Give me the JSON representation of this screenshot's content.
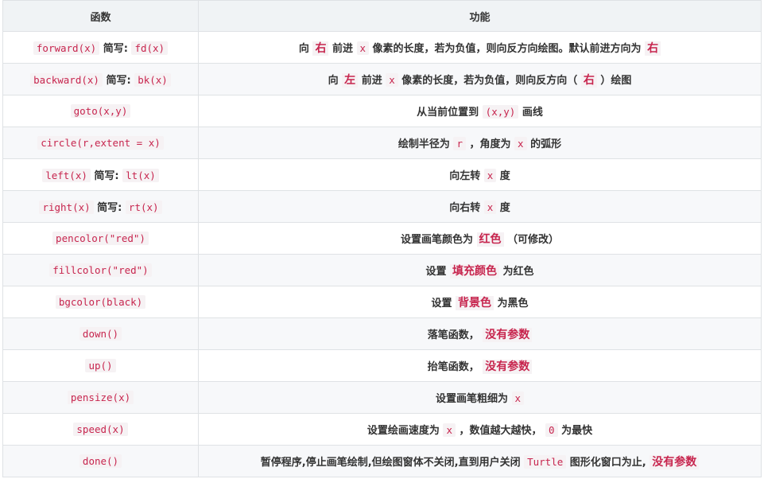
{
  "table": {
    "headers": [
      "函数",
      "功能"
    ],
    "rows": [
      {
        "func": [
          {
            "t": "code",
            "v": "forward(x)"
          },
          {
            "t": "text",
            "v": " 简写: "
          },
          {
            "t": "code",
            "v": "fd(x)"
          }
        ],
        "desc": [
          {
            "t": "text",
            "v": "向 "
          },
          {
            "t": "em",
            "v": "右"
          },
          {
            "t": "text",
            "v": " 前进 "
          },
          {
            "t": "code",
            "v": "x"
          },
          {
            "t": "text",
            "v": " 像素的长度，若为负值，则向反方向绘图。默认前进方向为 "
          },
          {
            "t": "em",
            "v": "右"
          }
        ]
      },
      {
        "func": [
          {
            "t": "code",
            "v": "backward(x)"
          },
          {
            "t": "text",
            "v": " 简写: "
          },
          {
            "t": "code",
            "v": "bk(x)"
          }
        ],
        "desc": [
          {
            "t": "text",
            "v": "向 "
          },
          {
            "t": "em",
            "v": "左"
          },
          {
            "t": "text",
            "v": " 前进 "
          },
          {
            "t": "code",
            "v": "x"
          },
          {
            "t": "text",
            "v": " 像素的长度，若为负值，则向反方向（ "
          },
          {
            "t": "em",
            "v": "右"
          },
          {
            "t": "text",
            "v": " ）绘图"
          }
        ]
      },
      {
        "func": [
          {
            "t": "code",
            "v": "goto(x,y)"
          }
        ],
        "desc": [
          {
            "t": "text",
            "v": "从当前位置到 "
          },
          {
            "t": "code",
            "v": "(x,y)"
          },
          {
            "t": "text",
            "v": " 画线"
          }
        ]
      },
      {
        "func": [
          {
            "t": "code",
            "v": "circle(r,extent = x)"
          }
        ],
        "desc": [
          {
            "t": "text",
            "v": "绘制半径为 "
          },
          {
            "t": "code",
            "v": "r"
          },
          {
            "t": "text",
            "v": " ，角度为 "
          },
          {
            "t": "code",
            "v": "x"
          },
          {
            "t": "text",
            "v": " 的弧形"
          }
        ]
      },
      {
        "func": [
          {
            "t": "code",
            "v": "left(x)"
          },
          {
            "t": "text",
            "v": " 简写: "
          },
          {
            "t": "code",
            "v": "lt(x)"
          }
        ],
        "desc": [
          {
            "t": "text",
            "v": "向左转 "
          },
          {
            "t": "code",
            "v": "x"
          },
          {
            "t": "text",
            "v": " 度"
          }
        ]
      },
      {
        "func": [
          {
            "t": "code",
            "v": "right(x)"
          },
          {
            "t": "text",
            "v": " 简写: "
          },
          {
            "t": "code",
            "v": "rt(x)"
          }
        ],
        "desc": [
          {
            "t": "text",
            "v": "向右转 "
          },
          {
            "t": "code",
            "v": "x"
          },
          {
            "t": "text",
            "v": " 度"
          }
        ]
      },
      {
        "func": [
          {
            "t": "code",
            "v": "pencolor(\"red\")"
          }
        ],
        "desc": [
          {
            "t": "text",
            "v": "设置画笔颜色为 "
          },
          {
            "t": "em",
            "v": "红色"
          },
          {
            "t": "text",
            "v": " （可修改）"
          }
        ]
      },
      {
        "func": [
          {
            "t": "code",
            "v": "fillcolor(\"red\")"
          }
        ],
        "desc": [
          {
            "t": "text",
            "v": "设置 "
          },
          {
            "t": "em",
            "v": "填充颜色"
          },
          {
            "t": "text",
            "v": " 为红色"
          }
        ]
      },
      {
        "func": [
          {
            "t": "code",
            "v": "bgcolor(black)"
          }
        ],
        "desc": [
          {
            "t": "text",
            "v": "设置 "
          },
          {
            "t": "em",
            "v": "背景色"
          },
          {
            "t": "text",
            "v": " 为黑色"
          }
        ]
      },
      {
        "func": [
          {
            "t": "code",
            "v": "down()"
          }
        ],
        "desc": [
          {
            "t": "text",
            "v": "落笔函数，  "
          },
          {
            "t": "em",
            "v": "没有参数"
          }
        ]
      },
      {
        "func": [
          {
            "t": "code",
            "v": "up()"
          }
        ],
        "desc": [
          {
            "t": "text",
            "v": "抬笔函数，  "
          },
          {
            "t": "em",
            "v": "没有参数"
          }
        ]
      },
      {
        "func": [
          {
            "t": "code",
            "v": "pensize(x)"
          }
        ],
        "desc": [
          {
            "t": "text",
            "v": "设置画笔粗细为 "
          },
          {
            "t": "code",
            "v": "x"
          }
        ]
      },
      {
        "func": [
          {
            "t": "code",
            "v": "speed(x)"
          }
        ],
        "desc": [
          {
            "t": "text",
            "v": "设置绘画速度为 "
          },
          {
            "t": "code",
            "v": "x"
          },
          {
            "t": "text",
            "v": " ，数值越大越快，  "
          },
          {
            "t": "code",
            "v": "0"
          },
          {
            "t": "text",
            "v": " 为最快"
          }
        ]
      },
      {
        "func": [
          {
            "t": "code",
            "v": "done()"
          }
        ],
        "desc": [
          {
            "t": "text",
            "v": "暂停程序,停止画笔绘制,但绘图窗体不关闭,直到用户关闭 "
          },
          {
            "t": "code",
            "v": "Turtle"
          },
          {
            "t": "text",
            "v": " 图形化窗口为止, "
          },
          {
            "t": "em",
            "v": "没有参数"
          }
        ]
      }
    ]
  }
}
